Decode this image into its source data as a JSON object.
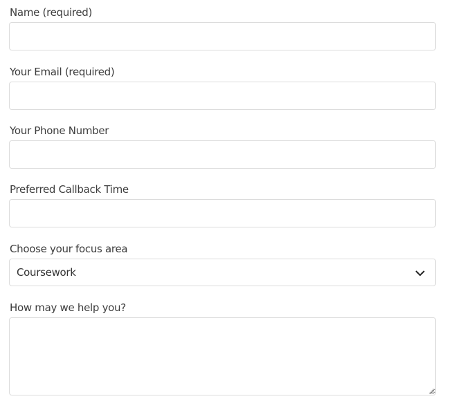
{
  "form": {
    "fields": [
      {
        "label": "Name (required)",
        "value": "",
        "placeholder": ""
      },
      {
        "label": "Your Email (required)",
        "value": "",
        "placeholder": ""
      },
      {
        "label": "Your Phone Number",
        "value": "",
        "placeholder": ""
      },
      {
        "label": "Preferred Callback Time",
        "value": "",
        "placeholder": ""
      }
    ],
    "focus_area": {
      "label": "Choose your focus area",
      "selected": "Coursework",
      "icon": "chevron-down-icon"
    },
    "message": {
      "label": "How may we help you?",
      "value": "",
      "icon": "resize-grip-icon"
    }
  }
}
